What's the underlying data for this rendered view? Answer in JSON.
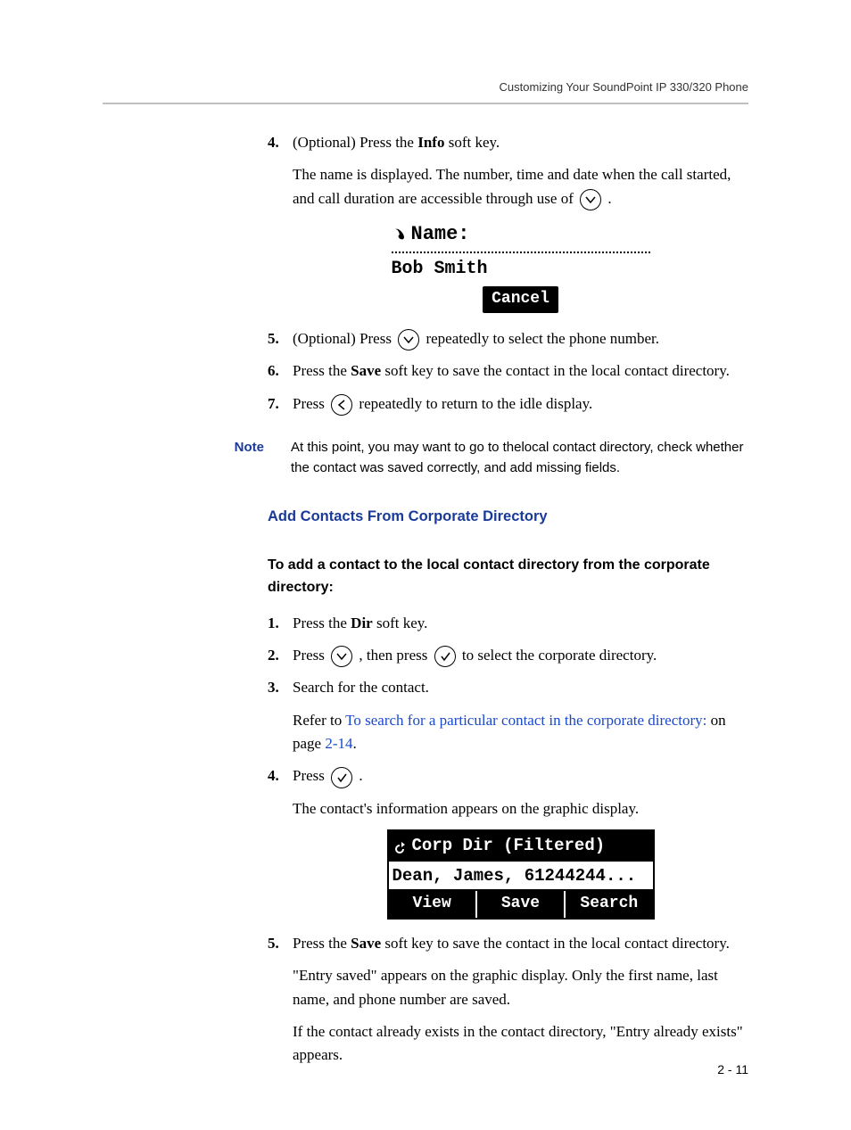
{
  "header": {
    "running": "Customizing Your SoundPoint IP 330/320 Phone"
  },
  "stepsA": {
    "s4": {
      "num": "4.",
      "line1_a": "(Optional) Press the ",
      "line1_b": "Info",
      "line1_c": " soft key.",
      "line2_a": "The name is displayed. The number, time and date when the call started, and call duration are accessible through use of ",
      "line2_b": " ."
    },
    "s5": {
      "num": "5.",
      "a": "(Optional) Press ",
      "b": " repeatedly to select the phone number."
    },
    "s6": {
      "num": "6.",
      "a": "Press the ",
      "b": "Save",
      "c": " soft key to save the contact in the local contact directory."
    },
    "s7": {
      "num": "7.",
      "a": "Press ",
      "b": " repeatedly to return to the idle display."
    }
  },
  "lcd1": {
    "title": "Name:",
    "value": "Bob Smith",
    "cancel": "Cancel"
  },
  "note": {
    "label": "Note",
    "text": "At this point, you may want to go to thelocal contact directory, check whether the contact was saved correctly, and add missing fields."
  },
  "sectionHead": "Add Contacts From Corporate Directory",
  "subhead": "To add a contact to the local contact directory from the corporate directory:",
  "stepsB": {
    "s1": {
      "num": "1.",
      "a": "Press the ",
      "b": "Dir",
      "c": " soft key."
    },
    "s2": {
      "num": "2.",
      "a": "Press ",
      "b": " , then press ",
      "c": " to select the corporate directory."
    },
    "s3": {
      "num": "3.",
      "a": "Search for the contact.",
      "b_pre": "Refer to ",
      "b_link": "To search for a particular contact in the corporate directory:",
      "b_mid": " on page ",
      "b_page": "2-14",
      "b_post": "."
    },
    "s4": {
      "num": "4.",
      "a": "Press ",
      "b": " .",
      "c": "The contact's information appears on the graphic display."
    },
    "s5": {
      "num": "5.",
      "a": "Press the ",
      "b": "Save",
      "c": " soft key to save the contact in the local contact directory.",
      "d": "\"Entry saved\" appears on the graphic display. Only the first name, last name, and phone number are saved.",
      "e": "If the contact already exists in the contact directory, \"Entry already exists\" appears."
    }
  },
  "lcd2": {
    "title": "Corp Dir (Filtered)",
    "row": "Dean, James, 61244244...",
    "view": "View",
    "save": "Save",
    "search": "Search"
  },
  "pageNum": "2 - 11"
}
